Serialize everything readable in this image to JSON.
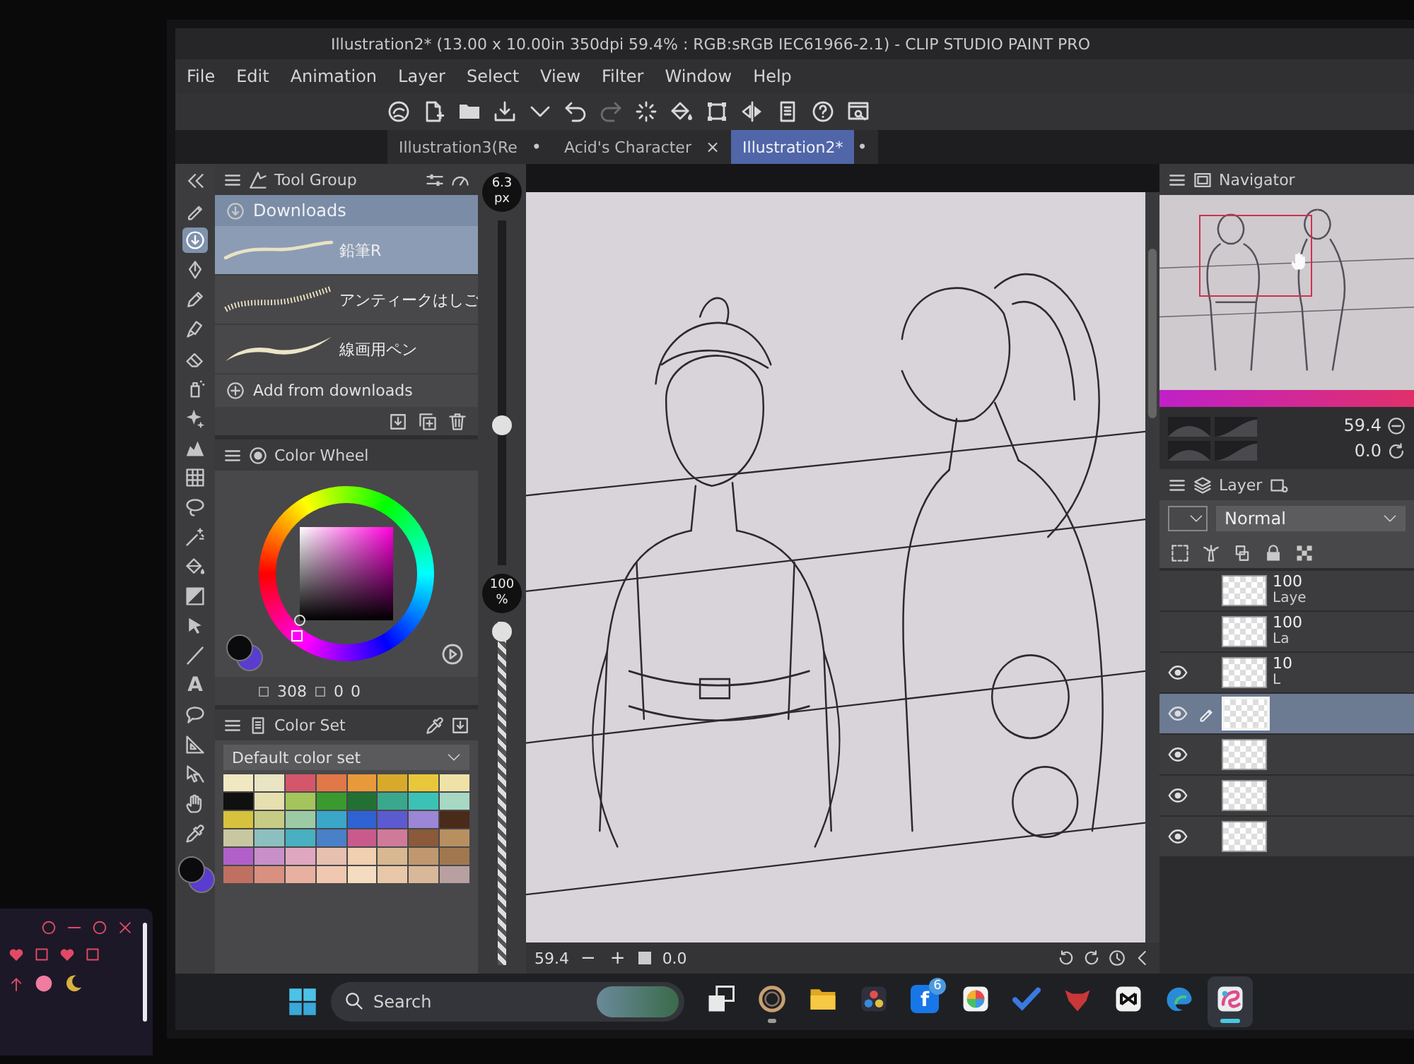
{
  "window": {
    "title": "Illustration2* (13.00 x 10.00in 350dpi 59.4% : RGB:sRGB IEC61966-2.1) - CLIP STUDIO PAINT PRO"
  },
  "menu": [
    "File",
    "Edit",
    "Animation",
    "Layer",
    "Select",
    "View",
    "Filter",
    "Window",
    "Help"
  ],
  "command_bar": [
    {
      "kind": "logo",
      "disabled": false
    },
    {
      "kind": "newfile",
      "disabled": false
    },
    {
      "kind": "folder",
      "disabled": false
    },
    {
      "kind": "save",
      "disabled": false
    },
    {
      "kind": "caret",
      "disabled": false
    },
    {
      "kind": "undo",
      "disabled": false
    },
    {
      "kind": "redo",
      "disabled": true
    },
    {
      "kind": "spinner",
      "disabled": false
    },
    {
      "kind": "bucket",
      "disabled": false
    },
    {
      "kind": "transform",
      "disabled": false
    },
    {
      "kind": "flip",
      "disabled": false
    },
    {
      "kind": "tablet",
      "disabled": false
    },
    {
      "kind": "help",
      "disabled": false
    },
    {
      "kind": "winsearch",
      "disabled": false
    }
  ],
  "document_tabs": [
    {
      "label": "Illustration3(Re",
      "mark": "•",
      "selected": false
    },
    {
      "label": "Acid's Character",
      "mark": "×",
      "selected": false
    },
    {
      "label": "Illustration2*",
      "mark": "•",
      "selected": true
    }
  ],
  "tools": [
    {
      "kind": "pen",
      "selected": false
    },
    {
      "kind": "download",
      "selected": true
    },
    {
      "kind": "nib",
      "selected": false
    },
    {
      "kind": "pencil",
      "selected": false
    },
    {
      "kind": "marker",
      "selected": false
    },
    {
      "kind": "eraser",
      "selected": false
    },
    {
      "kind": "spray",
      "selected": false
    },
    {
      "kind": "sparkle",
      "selected": false
    },
    {
      "kind": "blob",
      "selected": false
    },
    {
      "kind": "grid",
      "selected": false
    },
    {
      "kind": "lasso",
      "selected": false
    },
    {
      "kind": "wand",
      "selected": false
    },
    {
      "kind": "bucket",
      "selected": false
    },
    {
      "kind": "gradient",
      "selected": false
    },
    {
      "kind": "cursor",
      "selected": false
    },
    {
      "kind": "line",
      "selected": false
    },
    {
      "kind": "text",
      "label": "A",
      "selected": false
    },
    {
      "kind": "balloon",
      "selected": false
    },
    {
      "kind": "triangle",
      "selected": false
    },
    {
      "kind": "pointer",
      "selected": false
    },
    {
      "kind": "hand",
      "selected": false
    },
    {
      "kind": "dropper",
      "selected": false
    }
  ],
  "drawing_colors": [
    {
      "kind": "main",
      "color": "#0b0b0d"
    },
    {
      "kind": "sub",
      "color": "#5a3ccf"
    }
  ],
  "sub_tool": {
    "tab": "Tool Group",
    "group": "Downloads",
    "brushes": [
      {
        "name": "鉛筆R",
        "kind": "smooth",
        "selected": true
      },
      {
        "name": "アンティークはしご",
        "kind": "ladder",
        "selected": false
      },
      {
        "name": "線画用ペン",
        "kind": "taper",
        "selected": false
      }
    ],
    "add_label": "Add from downloads"
  },
  "brush_size": {
    "value": "6.3",
    "unit": "px",
    "level": 0.4
  },
  "opacity": {
    "value": "100",
    "unit": "%",
    "level": 1
  },
  "color_wheel": {
    "title": "Color Wheel",
    "values": [
      "308",
      "0",
      "0"
    ]
  },
  "color_set": {
    "tab": "Color Set",
    "name": "Default color set",
    "swatches": [
      {
        "color": "#f0e8c0"
      },
      {
        "color": "#e8e4c4"
      },
      {
        "color": "#d4566a"
      },
      {
        "color": "#e07848"
      },
      {
        "color": "#e89a3a"
      },
      {
        "color": "#d8aa2c"
      },
      {
        "color": "#e8c83a"
      },
      {
        "color": "#efe2a8"
      },
      {
        "color": "#101010"
      },
      {
        "color": "#e6dfb0"
      },
      {
        "color": "#a4c45c"
      },
      {
        "color": "#3a9a2e"
      },
      {
        "color": "#237034"
      },
      {
        "color": "#3aa88c"
      },
      {
        "color": "#3cc2b4"
      },
      {
        "color": "#a6d8c4"
      },
      {
        "color": "#d6c23c"
      },
      {
        "color": "#c6cc84"
      },
      {
        "color": "#9ccaa4"
      },
      {
        "color": "#3aa6c8"
      },
      {
        "color": "#2f62d2"
      },
      {
        "color": "#5c5ad0"
      },
      {
        "color": "#9c86d6"
      },
      {
        "color": "#4a2a18"
      },
      {
        "color": "#c8c8a0"
      },
      {
        "color": "#8cc0c0"
      },
      {
        "color": "#48b0c0"
      },
      {
        "color": "#4a80c8"
      },
      {
        "color": "#c85a8c"
      },
      {
        "color": "#d07a9a"
      },
      {
        "color": "#8a5a3a"
      },
      {
        "color": "#b89060"
      },
      {
        "color": "#b060c8"
      },
      {
        "color": "#c890c8"
      },
      {
        "color": "#e0a8c0"
      },
      {
        "color": "#e8c0b0"
      },
      {
        "color": "#f0d0b0"
      },
      {
        "color": "#d8b890"
      },
      {
        "color": "#c09870"
      },
      {
        "color": "#a07850"
      },
      {
        "color": "#c07060"
      },
      {
        "color": "#d89080"
      },
      {
        "color": "#e8b0a0"
      },
      {
        "color": "#f0c8b0"
      },
      {
        "color": "#f4dcc0"
      },
      {
        "color": "#e8c8a8"
      },
      {
        "color": "#d8b898"
      },
      {
        "color": "#b8a0a0"
      }
    ]
  },
  "canvas_status": {
    "zoom": "59.4",
    "zoom_out": "−",
    "zoom_in": "+",
    "angle": "0.0"
  },
  "navigator": {
    "title": "Navigator",
    "zoom": "59.4",
    "angle": "0.0"
  },
  "layer_panel": {
    "title": "Layer",
    "blend_mode": "Normal",
    "layers": [
      {
        "opacity": "100",
        "name": "Laye",
        "visible": false,
        "selected": false
      },
      {
        "opacity": "100",
        "name": "La",
        "visible": false,
        "selected": false
      },
      {
        "opacity": "10",
        "name": "L",
        "visible": true,
        "selected": false
      },
      {
        "visible": true,
        "selected": true
      },
      {
        "visible": true,
        "selected": false
      },
      {
        "visible": true,
        "selected": false
      },
      {
        "visible": true,
        "selected": false
      }
    ]
  },
  "taskbar": {
    "search": {
      "placeholder": "Search"
    },
    "apps": [
      {
        "kind": "squares",
        "open": false,
        "active": false
      },
      {
        "kind": "ring",
        "open": true,
        "active": false
      },
      {
        "kind": "folder",
        "open": false,
        "active": false
      },
      {
        "kind": "circles",
        "open": false,
        "active": false
      },
      {
        "kind": "letter",
        "label": "f",
        "badge": "6",
        "open": false,
        "active": false
      },
      {
        "kind": "pie",
        "open": false,
        "active": false
      },
      {
        "kind": "check",
        "open": false,
        "active": false
      },
      {
        "kind": "mask",
        "open": false,
        "active": false
      },
      {
        "kind": "tile",
        "open": false,
        "active": false
      },
      {
        "kind": "swirl",
        "open": false,
        "active": false
      },
      {
        "kind": "brush",
        "open": true,
        "active": true
      }
    ]
  }
}
